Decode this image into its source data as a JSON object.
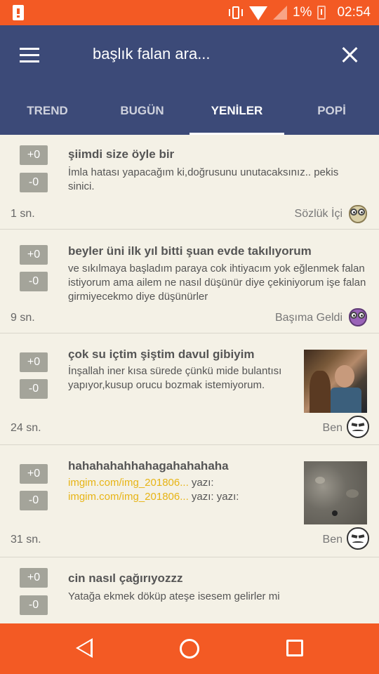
{
  "status_bar": {
    "battery_percent": "1%",
    "time": "02:54"
  },
  "app_bar": {
    "search_text": "başlık falan ara...",
    "tabs": [
      {
        "label": "TREND",
        "active": false
      },
      {
        "label": "BUGÜN",
        "active": false
      },
      {
        "label": "YENİLER",
        "active": true
      },
      {
        "label": "POPİ",
        "active": false
      }
    ]
  },
  "posts": [
    {
      "upvote": "+0",
      "downvote": "-0",
      "title": "şiimdi size öyle bir",
      "body": "İmla hatası yapacağım ki,doğrusunu unutacaksınız.. pekis sinici.",
      "time": "1 sn.",
      "category": "Sözlük İçi",
      "category_icon": "owl-beige-icon"
    },
    {
      "upvote": "+0",
      "downvote": "-0",
      "title": "beyler üni ilk yıl bitti şuan evde takılıyorum",
      "body": "ve sıkılmaya başladım paraya cok ihtiyacım yok eğlenmek falan istiyorum ama ailem ne nasıl düşünür diye çekiniyorum işe falan girmiyecekmo diye düşünürler",
      "time": "9 sn.",
      "category": "Başıma Geldi",
      "category_icon": "owl-purple-icon"
    },
    {
      "upvote": "+0",
      "downvote": "-0",
      "title": "çok su içtim şiştim davul gibiyim",
      "body": "İnşallah iner kısa sürede çünkü mide bulantısı yapıyor,kusup orucu bozmak istemiyorum.",
      "time": "24 sn.",
      "category": "Ben",
      "category_icon": "mask-icon",
      "thumbnail": "photo-thumbnail"
    },
    {
      "upvote": "+0",
      "downvote": "-0",
      "title": "hahahahahhahagahahahaha",
      "link1": "imgim.com/img_201806...",
      "text1": " yazı: ",
      "link2": "imgim.com/img_201806...",
      "text2": " yazı: yazı:",
      "time": "31 sn.",
      "category": "Ben",
      "category_icon": "mask-icon",
      "thumbnail": "ground-photo-thumbnail"
    },
    {
      "upvote": "+0",
      "downvote": "-0",
      "title": "cin nasıl çağırıyozzz",
      "body": "Yatağa ekmek döküp ateşe isesem gelirler mi"
    }
  ]
}
